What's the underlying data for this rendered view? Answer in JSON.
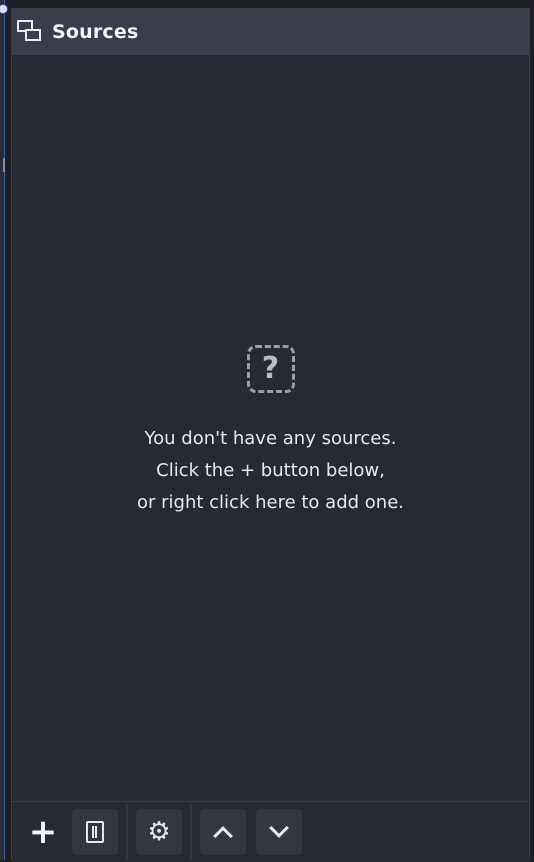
{
  "panel": {
    "title": "Sources",
    "title_icon": "sources-windows-icon"
  },
  "empty_state": {
    "icon": "question-mark-icon",
    "icon_glyph": "?",
    "line1": "You don't have any sources.",
    "line2": "Click the + button below,",
    "line3": "or right click here to add one."
  },
  "toolbar": {
    "add_glyph": "+",
    "add_icon": "plus-icon",
    "remove_icon": "trash-icon",
    "properties_icon": "gear-icon",
    "properties_glyph": "⚙",
    "move_up_icon": "chevron-up-icon",
    "move_down_icon": "chevron-down-icon"
  },
  "colors": {
    "background": "#272a33",
    "titlebar": "#3a3d4a",
    "text": "#f2f4f8",
    "accent": "#3f5f9e"
  }
}
